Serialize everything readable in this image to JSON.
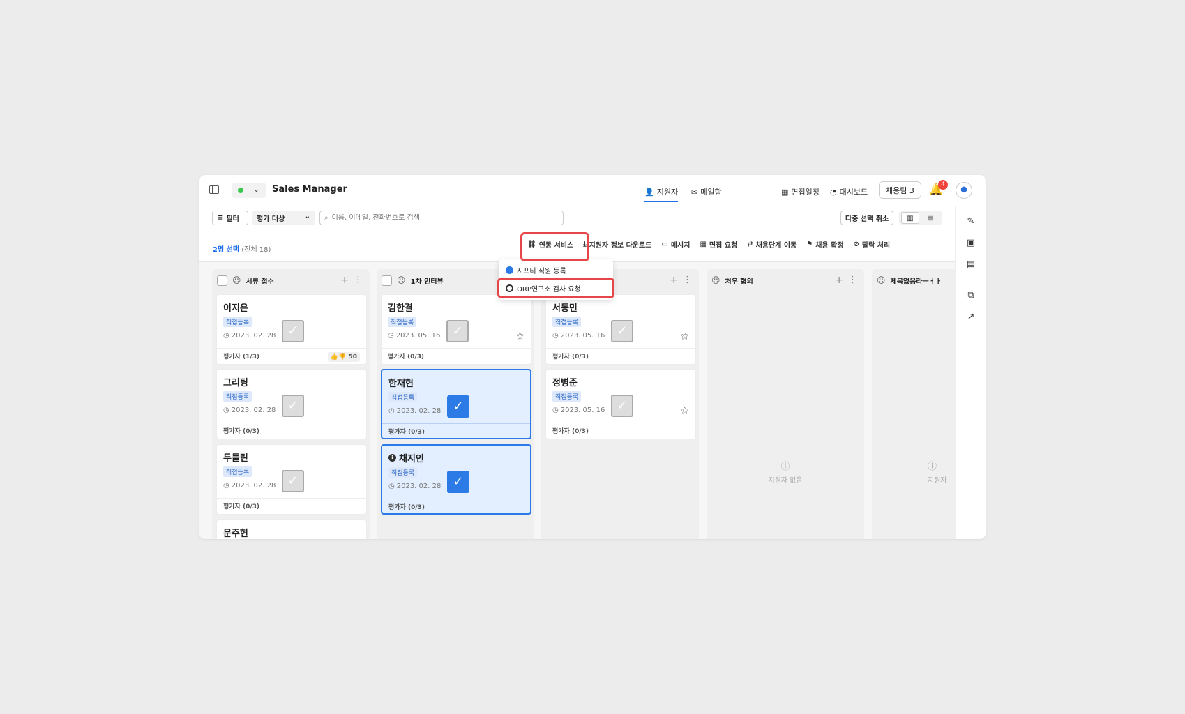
{
  "header": {
    "title": "Sales Manager",
    "nav": [
      {
        "icon": "person-icon",
        "label": "지원자",
        "active": true
      },
      {
        "icon": "mail-icon",
        "label": "메일함",
        "active": false
      },
      {
        "icon": "calendar-icon",
        "label": "면접일정",
        "active": false
      },
      {
        "icon": "dashboard-icon",
        "label": "대시보드",
        "active": false
      }
    ],
    "team_button": "채용팀 3",
    "notification_count": "4"
  },
  "toolbar": {
    "filter_label": "필터",
    "eval_select": "평가 대상",
    "search_placeholder": "이름, 이메일, 전화번호로 검색",
    "multi_select_cancel": "다중 선택 취소"
  },
  "selection": {
    "selected": "2명 선택",
    "total": "(전체 18)"
  },
  "actions": [
    {
      "icon": "link-icon",
      "label": "연동 서비스"
    },
    {
      "icon": "download-icon",
      "label": "지원자 정보 다운로드"
    },
    {
      "icon": "message-icon",
      "label": "메시지"
    },
    {
      "icon": "calendar-icon",
      "label": "면접 요청"
    },
    {
      "icon": "move-icon",
      "label": "채용단계 이동"
    },
    {
      "icon": "flag-icon",
      "label": "채용 확정"
    },
    {
      "icon": "ban-icon",
      "label": "탈락 처리"
    }
  ],
  "dropdown": {
    "items": [
      {
        "icon": "shift-logo-icon",
        "label": "시프티 직원 등록"
      },
      {
        "icon": "orp-logo-icon",
        "label": "ORP연구소 검사 요청"
      }
    ]
  },
  "columns": [
    {
      "title": "서류 접수",
      "cards": [
        {
          "name": "이지은",
          "tag": "직접등록",
          "date": "2023. 02. 28",
          "footer": "평가자 (1/3)",
          "votes": "50",
          "selected": false
        },
        {
          "name": "그리팅",
          "tag": "직접등록",
          "date": "2023. 02. 28",
          "footer": "평가자 (0/3)",
          "selected": false
        },
        {
          "name": "두들린",
          "tag": "직접등록",
          "date": "2023. 02. 28",
          "footer": "평가자 (0/3)",
          "selected": false
        },
        {
          "name": "문주현",
          "tag": "",
          "date": "",
          "footer": "",
          "selected": false
        }
      ]
    },
    {
      "title": "1차 인터뷰",
      "cards": [
        {
          "name": "김한결",
          "tag": "직접등록",
          "date": "2023. 05. 16",
          "footer": "평가자 (0/3)",
          "selected": false
        },
        {
          "name": "한재현",
          "tag": "직접등록",
          "date": "2023. 02. 28",
          "footer": "평가자 (0/3)",
          "selected": true
        },
        {
          "name": "채지인",
          "tag": "직접등록",
          "date": "2023. 02. 28",
          "footer": "평가자 (0/3)",
          "selected": true
        }
      ]
    },
    {
      "title": "",
      "cards": [
        {
          "name": "서동민",
          "tag": "직접등록",
          "date": "2023. 05. 16",
          "footer": "평가자 (0/3)",
          "selected": false
        },
        {
          "name": "정병준",
          "tag": "직접등록",
          "date": "2023. 05. 16",
          "footer": "평가자 (0/3)",
          "selected": false
        }
      ]
    },
    {
      "title": "처우 협의",
      "empty_text": "지원자 없음",
      "cards": []
    },
    {
      "title": "제목없음라ㅡㅓㅏ",
      "empty_text": "지원자",
      "cards": []
    }
  ],
  "colors": {
    "accent": "#2b7ae6",
    "highlight": "#e8474a",
    "badge": "#f0433c",
    "status_dot": "#3cc74e"
  }
}
